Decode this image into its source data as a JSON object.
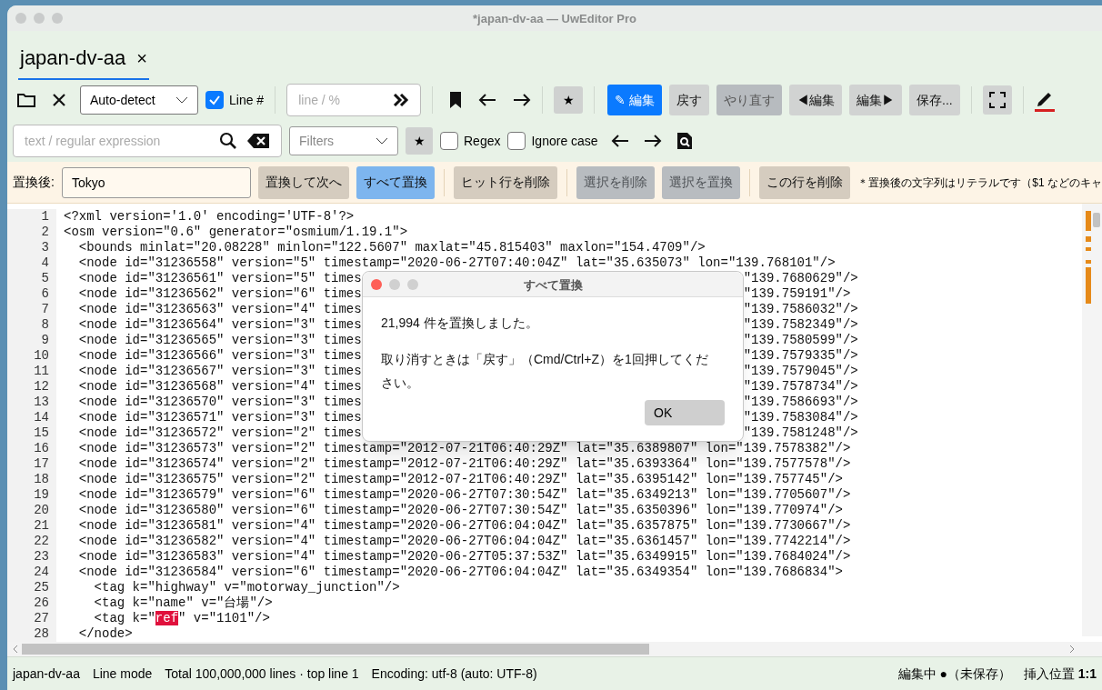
{
  "window": {
    "title": "*japan-dv-aa — UwEditor Pro"
  },
  "tabs": [
    {
      "label": "japan-dv-aa",
      "close": "×",
      "selected": true
    }
  ],
  "toolbar": {
    "encoding": "Auto-detect",
    "line_numbers": {
      "label": "Line #",
      "checked": true
    },
    "goto": {
      "placeholder": "line / %"
    },
    "star": "★",
    "buttons": [
      {
        "label": "✎ 編集",
        "kind": "primary",
        "disabled": false
      },
      {
        "label": "戻す",
        "kind": "normal",
        "disabled": false
      },
      {
        "label": "やり直す",
        "kind": "normal",
        "disabled": true
      },
      {
        "label": "◀編集",
        "kind": "normal",
        "disabled": false
      },
      {
        "label": "編集▶",
        "kind": "normal",
        "disabled": false
      },
      {
        "label": "保存...",
        "kind": "normal",
        "disabled": false
      }
    ]
  },
  "search": {
    "placeholder": "text / regular expression",
    "filters": "Filters",
    "star": "★",
    "options": [
      {
        "label": "Regex",
        "checked": false
      },
      {
        "label": "Ignore case",
        "checked": false
      }
    ]
  },
  "replace": {
    "label": "置換後:",
    "value": "Tokyo",
    "button_groups": [
      [
        {
          "label": "置換して次へ",
          "kind": "tan"
        },
        {
          "label": "すべて置換",
          "kind": "blue"
        }
      ],
      [
        {
          "label": "ヒット行を削除",
          "kind": "tan"
        }
      ],
      [
        {
          "label": "選択を削除",
          "kind": "disabled"
        },
        {
          "label": "選択を置換",
          "kind": "disabled"
        }
      ],
      [
        {
          "label": "この行を削除",
          "kind": "tan"
        }
      ]
    ],
    "note": "＊置換後の文字列はリテラルです（$1 などのキャ"
  },
  "editor": {
    "lines": [
      {
        "n": "1",
        "kind": "plain",
        "text": "<?xml version='1.0' encoding='UTF-8'?>"
      },
      {
        "n": "2",
        "kind": "plain",
        "text": "<osm version=\"0.6\" generator=\"osmium/1.19.1\">"
      },
      {
        "n": "3",
        "kind": "plain",
        "text": "  <bounds minlat=\"20.08228\" minlon=\"122.5607\" maxlat=\"45.815403\" maxlon=\"154.4709\"/>"
      },
      {
        "n": "4",
        "kind": "plain",
        "text": "  <node id=\"31236558\" version=\"5\" timestamp=\"2020-06-27T07:40:04Z\" lat=\"35.635073\" lon=\"139.768101\"/>"
      },
      {
        "n": "5",
        "kind": "covered",
        "start": "  <node id=\"31236561\" version=\"5\" times",
        "end": "\"139.7680629\"/>"
      },
      {
        "n": "6",
        "kind": "covered",
        "start": "  <node id=\"31236562\" version=\"6\" times",
        "end": "\"139.759191\"/>"
      },
      {
        "n": "7",
        "kind": "covered",
        "start": "  <node id=\"31236563\" version=\"4\" times",
        "end": "\"139.7586032\"/>"
      },
      {
        "n": "8",
        "kind": "covered",
        "start": "  <node id=\"31236564\" version=\"3\" times",
        "end": "\"139.7582349\"/>"
      },
      {
        "n": "9",
        "kind": "covered",
        "start": "  <node id=\"31236565\" version=\"3\" times",
        "end": "\"139.7580599\"/>"
      },
      {
        "n": "10",
        "kind": "covered",
        "start": "  <node id=\"31236566\" version=\"3\" times",
        "end": "\"139.7579335\"/>"
      },
      {
        "n": "11",
        "kind": "covered",
        "start": "  <node id=\"31236567\" version=\"3\" times",
        "end": "\"139.7579045\"/>"
      },
      {
        "n": "12",
        "kind": "covered",
        "start": "  <node id=\"31236568\" version=\"4\" times",
        "end": "\"139.7578734\"/>"
      },
      {
        "n": "13",
        "kind": "covered",
        "start": "  <node id=\"31236570\" version=\"3\" times",
        "end": "\"139.7586693\"/>"
      },
      {
        "n": "14",
        "kind": "covered",
        "start": "  <node id=\"31236571\" version=\"3\" times",
        "end": "\"139.7583084\"/>"
      },
      {
        "n": "15",
        "kind": "covered",
        "start": "  <node id=\"31236572\" version=\"2\" times",
        "end": "\"139.7581248\"/>"
      },
      {
        "n": "16",
        "kind": "plain",
        "text": "  <node id=\"31236573\" version=\"2\" timestamp=\"2012-07-21T06:40:29Z\" lat=\"35.6389807\" lon=\"139.7578382\"/>"
      },
      {
        "n": "17",
        "kind": "plain",
        "text": "  <node id=\"31236574\" version=\"2\" timestamp=\"2012-07-21T06:40:29Z\" lat=\"35.6393364\" lon=\"139.7577578\"/>"
      },
      {
        "n": "18",
        "kind": "plain",
        "text": "  <node id=\"31236575\" version=\"2\" timestamp=\"2012-07-21T06:40:29Z\" lat=\"35.6395142\" lon=\"139.757745\"/>"
      },
      {
        "n": "19",
        "kind": "plain",
        "text": "  <node id=\"31236579\" version=\"6\" timestamp=\"2020-06-27T07:30:54Z\" lat=\"35.6349213\" lon=\"139.7705607\"/>"
      },
      {
        "n": "20",
        "kind": "plain",
        "text": "  <node id=\"31236580\" version=\"6\" timestamp=\"2020-06-27T07:30:54Z\" lat=\"35.6350396\" lon=\"139.770974\"/>"
      },
      {
        "n": "21",
        "kind": "plain",
        "text": "  <node id=\"31236581\" version=\"4\" timestamp=\"2020-06-27T06:04:04Z\" lat=\"35.6357875\" lon=\"139.7730667\"/>"
      },
      {
        "n": "22",
        "kind": "plain",
        "text": "  <node id=\"31236582\" version=\"4\" timestamp=\"2020-06-27T06:04:04Z\" lat=\"35.6361457\" lon=\"139.7742214\"/>"
      },
      {
        "n": "23",
        "kind": "plain",
        "text": "  <node id=\"31236583\" version=\"4\" timestamp=\"2020-06-27T05:37:53Z\" lat=\"35.6349915\" lon=\"139.7684024\"/>"
      },
      {
        "n": "24",
        "kind": "plain",
        "text": "  <node id=\"31236584\" version=\"6\" timestamp=\"2020-06-27T06:04:04Z\" lat=\"35.6349354\" lon=\"139.7686834\">"
      },
      {
        "n": "25",
        "kind": "plain",
        "text": "    <tag k=\"highway\" v=\"motorway_junction\"/>"
      },
      {
        "n": "26",
        "kind": "plain",
        "text": "    <tag k=\"name\" v=\"台場\"/>"
      },
      {
        "n": "27",
        "kind": "match",
        "before": "    <tag k=\"",
        "match": "ref",
        "after": "\" v=\"1101\"/>"
      },
      {
        "n": "28",
        "kind": "plain",
        "text": "  </node>"
      }
    ]
  },
  "dialog": {
    "title": "すべて置換",
    "message": "21,994 件を置換しました。",
    "hint": "取り消すときは「戻す」（Cmd/Ctrl+Z）を1回押してください。",
    "ok": "OK"
  },
  "status_bar": {
    "items": [
      "japan-dv-aa",
      "Line mode",
      "Total 100,000,000 lines · top line 1",
      "Encoding: utf-8 (auto: UTF-8)"
    ],
    "state": "編集中 ●（未保存）",
    "position": "挿入位置 **1:1**"
  }
}
